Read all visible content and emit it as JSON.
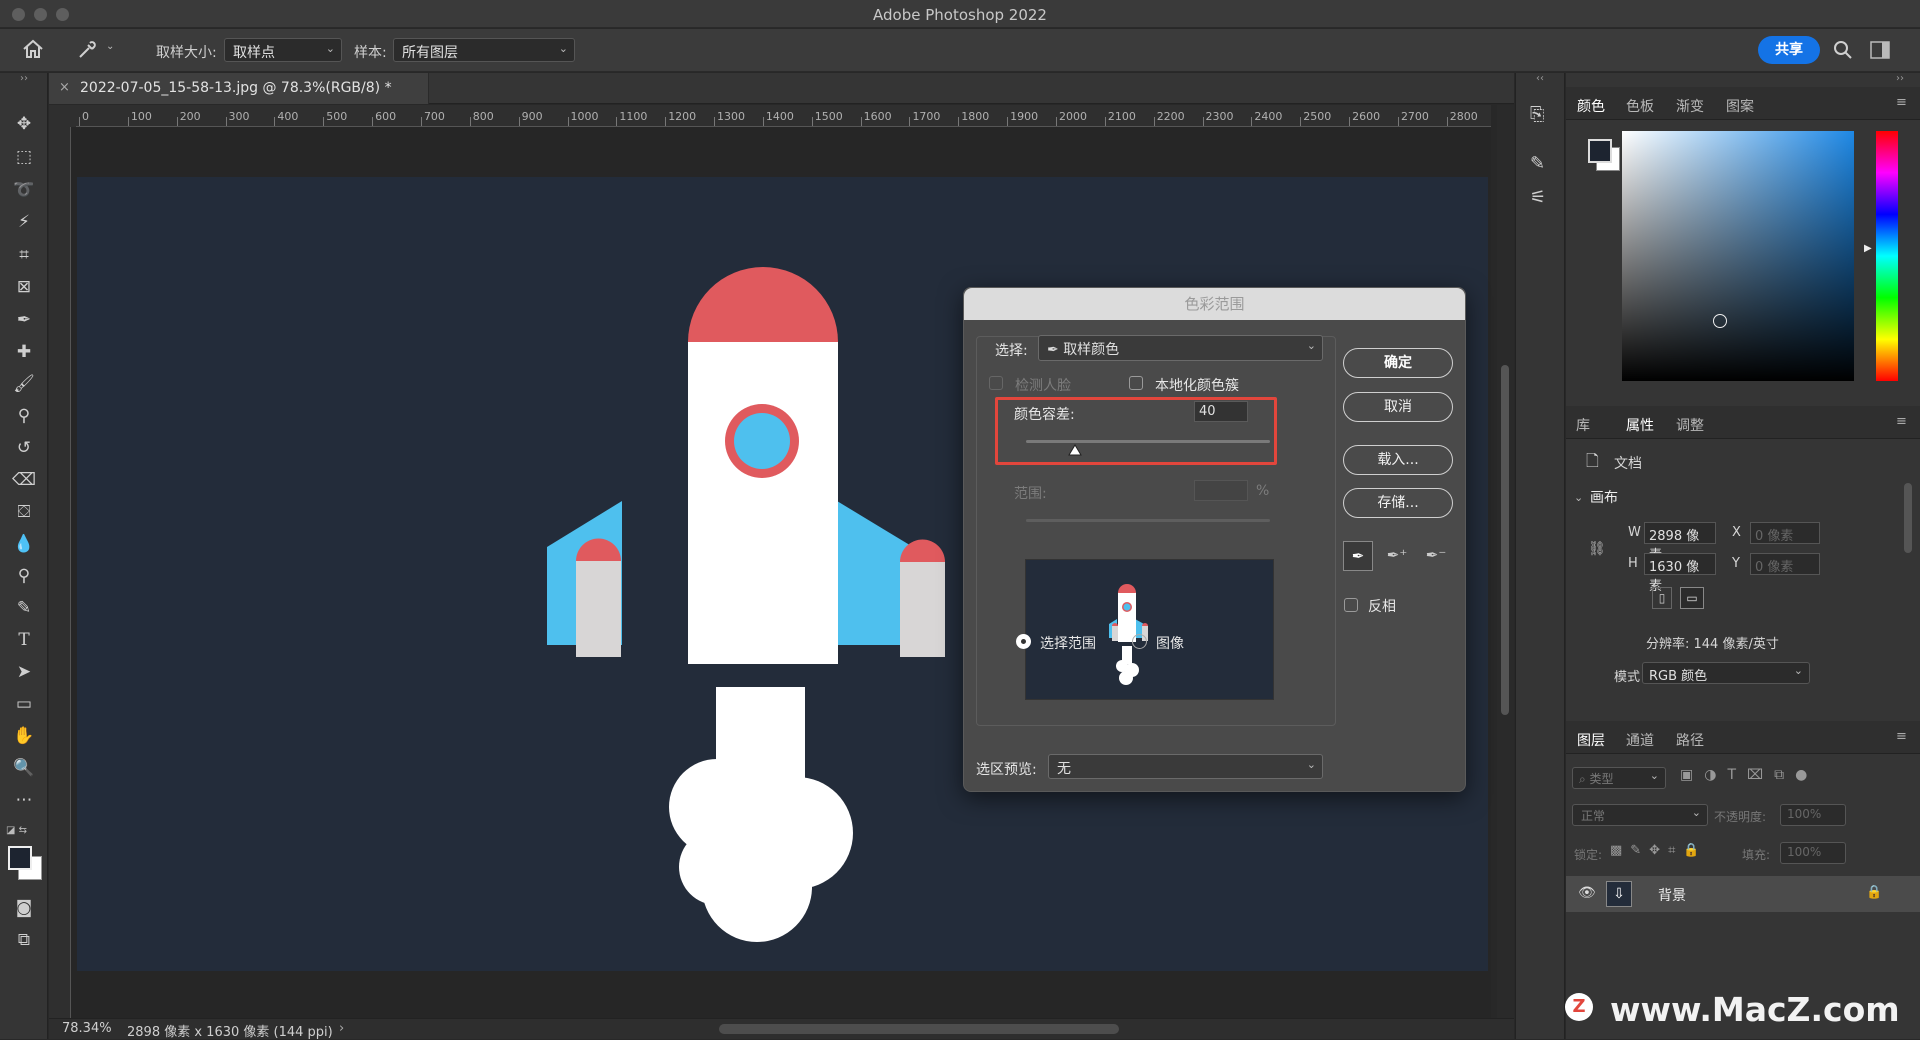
{
  "app": {
    "title": "Adobe Photoshop 2022"
  },
  "options_bar": {
    "sample_size_label": "取样大小:",
    "sample_size_value": "取样点",
    "sample_label": "样本:",
    "sample_value": "所有图层",
    "share_label": "共享"
  },
  "document": {
    "tab_title": "2022-07-05_15-58-13.jpg @ 78.3%(RGB/8) *",
    "ruler_ticks": [
      "0",
      "100",
      "200",
      "300",
      "400",
      "500",
      "600",
      "700",
      "800",
      "900",
      "1000",
      "1100",
      "1200",
      "1300",
      "1400",
      "1500",
      "1600",
      "1700",
      "1800",
      "1900",
      "2000",
      "2100",
      "2200",
      "2300",
      "2400",
      "2500",
      "2600",
      "2700",
      "2800"
    ],
    "canvas_color": "#232c3a"
  },
  "status": {
    "zoom": "78.34%",
    "info": "2898 像素 x 1630 像素 (144 ppi)"
  },
  "color_panel": {
    "tabs": [
      "颜色",
      "色板",
      "渐变",
      "图案"
    ],
    "active_tab": "颜色"
  },
  "properties_panel": {
    "tabs": [
      "库",
      "属性",
      "调整"
    ],
    "doc_label": "文档",
    "section": "画布",
    "w_label": "W",
    "w_value": "2898 像素",
    "h_label": "H",
    "h_value": "1630 像素",
    "x_label": "X",
    "x_placeholder": "0 像素",
    "y_label": "Y",
    "y_placeholder": "0 像素",
    "resolution": "分辨率: 144 像素/英寸",
    "mode_label": "模式",
    "mode_value": "RGB 颜色"
  },
  "layers_panel": {
    "tabs": [
      "图层",
      "通道",
      "路径"
    ],
    "filter_placeholder": "类型",
    "blend_mode": "正常",
    "opacity_label": "不透明度:",
    "opacity_value": "100%",
    "lock_label": "锁定:",
    "fill_label": "填充:",
    "fill_value": "100%",
    "layers": [
      {
        "name": "背景"
      }
    ]
  },
  "dialog": {
    "title": "色彩范围",
    "select_label": "选择:",
    "select_value": "取样颜色",
    "detect_faces": "检测人脸",
    "localized_clusters": "本地化颜色簇",
    "fuzziness_label": "颜色容差:",
    "fuzziness_value": "40",
    "fuzziness_fraction": 0.2,
    "range_label": "范围:",
    "range_unit": "%",
    "ok": "确定",
    "cancel": "取消",
    "load": "载入...",
    "save": "存储...",
    "invert": "反相",
    "radio_selection": "选择范围",
    "radio_image": "图像",
    "preview_label": "选区预览:",
    "preview_value": "无"
  },
  "watermark": {
    "text": "www.MacZ.com",
    "logo": "Z"
  },
  "colors": {
    "accent": "#1473e6",
    "highlight_box": "#e2463c",
    "rocket_red": "#e05a5e",
    "rocket_blue": "#4ec0ee",
    "rocket_gray": "#d8d6d6"
  }
}
